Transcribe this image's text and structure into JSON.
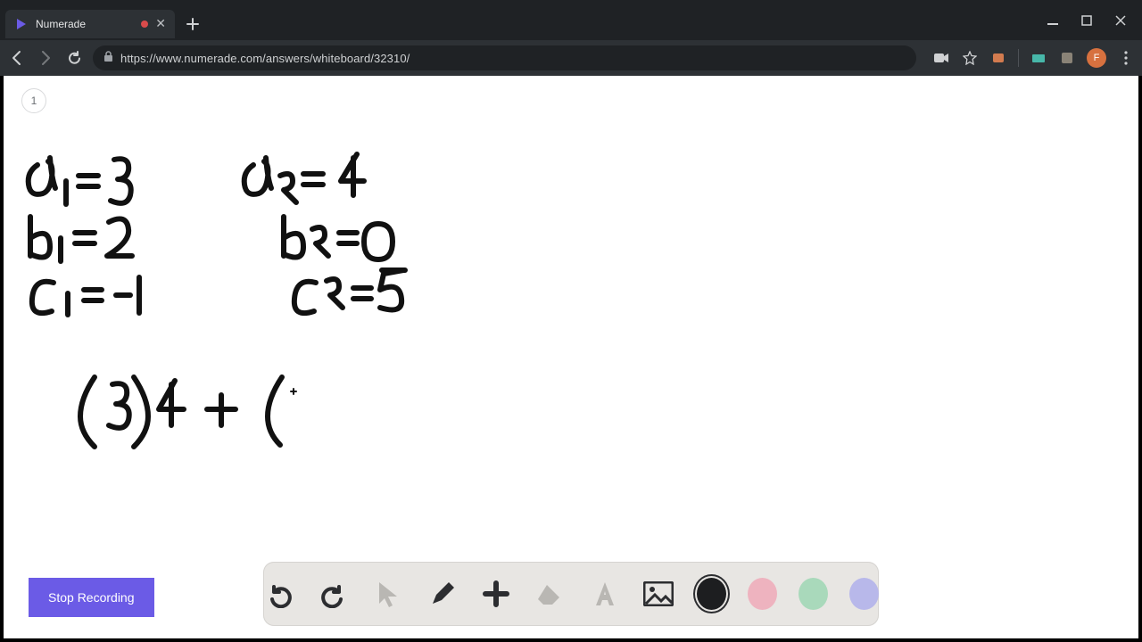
{
  "window": {
    "tab_title": "Numerade",
    "has_unsaved_indicator": true
  },
  "addressbar": {
    "url": "https://www.numerade.com/answers/whiteboard/32310/",
    "avatar_initial": "F"
  },
  "page": {
    "page_number": "1",
    "stop_label": "Stop Recording"
  },
  "handwriting": {
    "line1_left": "a₁ = 3",
    "line1_right": "a₂ = 4",
    "line2_left": "b₁ = 2",
    "line2_right": "b₂ = 0",
    "line3_left": "c₁ = -1",
    "line3_right": "c₂ = 5",
    "expr": "(3)4  +  ("
  },
  "toolbar": {
    "undo": "undo-icon",
    "redo": "redo-icon",
    "pointer": "pointer-icon",
    "pen": "pen-icon",
    "add": "add-icon",
    "eraser": "eraser-icon",
    "text": "text-icon",
    "image": "image-icon",
    "colors": {
      "black": "#1d1e20",
      "pink": "#eeb3bf",
      "green": "#a9d9bb",
      "purple": "#b8b8ea"
    },
    "active_color": "black"
  }
}
